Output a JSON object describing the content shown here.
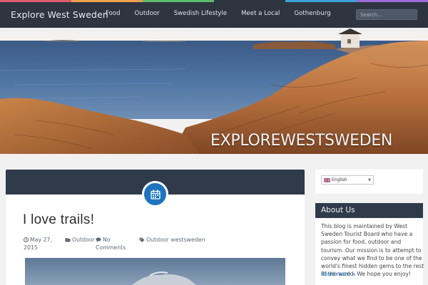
{
  "colors": {
    "nav_bg": "#2e3440",
    "accent": "#1e73be",
    "card_header": "#2f3a4b",
    "stripe": [
      "#e05b6b",
      "#f0a04b",
      "#5fb96e",
      "#2e3440",
      "#39a3d6",
      "#9b6bd6"
    ]
  },
  "site": {
    "brand": "Explore West Sweden"
  },
  "nav": {
    "items": [
      "Food",
      "Outdoor",
      "Swedish Lifestyle",
      "Meet a Local",
      "Gothenburg"
    ],
    "search_placeholder": "Search..."
  },
  "hero": {
    "title": "EXPLOREWESTSWEDEN"
  },
  "post": {
    "title": "I love trails!",
    "date_line1": "May 27,",
    "date_line2": "2015",
    "category": "Outdoor",
    "comments_line1": "No",
    "comments_line2": "Comments",
    "tags": "Outdoor westsweden",
    "icons": [
      "calendar-icon",
      "clock-icon",
      "folder-icon",
      "comment-icon",
      "tag-icon"
    ]
  },
  "sidebar": {
    "language": {
      "selected": "English"
    },
    "about": {
      "title": "About Us",
      "text": "This blog is maintained by West Sweden Tourist Board who have a passion for food, outdoor and tourism. Our mission is to attempt to convey what we find to be one of the world's finest hidden gems to the rest of the world. We hope you enjoy!",
      "read_more": "Read more »"
    }
  }
}
